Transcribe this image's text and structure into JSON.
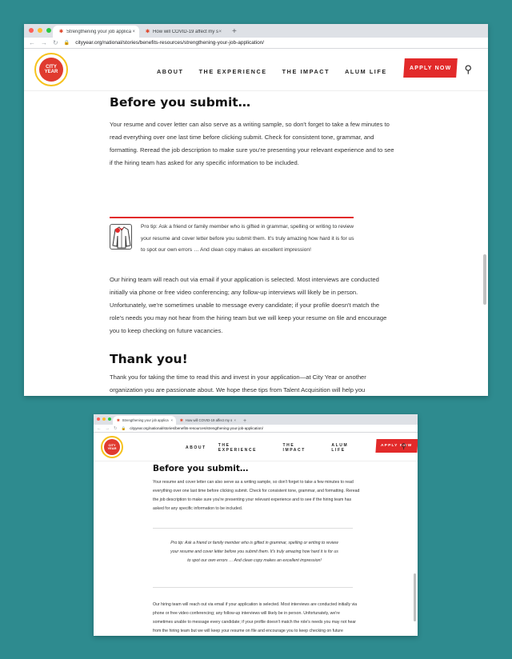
{
  "browser": {
    "tabs": [
      {
        "label": "Strengthening your job application",
        "short": "Strengthening your job applica"
      },
      {
        "label": "How will COVID-19 affect my service",
        "short": "How will COVID-19 affect my s"
      }
    ],
    "new_tab": "+",
    "url": "cityyear.org/national/stories/benefits-resources/strengthening-your-job-application/"
  },
  "site": {
    "logo_text": "CITY YEAR",
    "nav": [
      "ABOUT",
      "THE EXPERIENCE",
      "THE IMPACT",
      "ALUM LIFE"
    ],
    "apply_label": "APPLY NOW"
  },
  "article": {
    "heading1": "Before you submit…",
    "para1": "Your resume and cover letter can also serve as a writing sample, so don't forget to take a few minutes to read everything over one last time before clicking submit. Check for consistent tone, grammar, and formatting. Reread the job description to make sure you're presenting your relevant experience and to see if the hiring team has asked for any specific information to be included.",
    "tip": "Pro tip: Ask a friend or family member who is gifted in grammar, spelling or writing to review your resume and cover letter before you submit them. It's truly amazing how hard it is for us to spot our own errors … And clean copy makes an excellent impression!",
    "para2": "Our hiring team will reach out via email if your application is selected. Most interviews are conducted initially via phone or free video conferencing; any follow-up interviews will likely be in person. Unfortunately, we're sometimes unable to message every candidate; if your profile doesn't match the role's needs you may not hear from the hiring team but we will keep your resume on file and encourage you to keep checking on future vacancies.",
    "heading2": "Thank you!",
    "para3": "Thank you for taking the time to read this and invest in your application—at City Year or another organization you are passionate about. We hope these tips from Talent Acquisition will help you"
  },
  "colors": {
    "background": "#2e8b8f",
    "brand_red": "#e22a2a",
    "logo_yellow": "#f6c21d"
  }
}
